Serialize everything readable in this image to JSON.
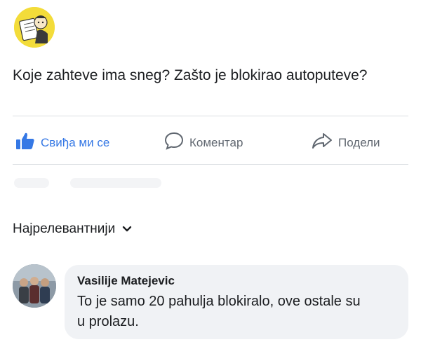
{
  "post": {
    "text": "Koje zahteve ima sneg? Zašto je blokirao autoputeve?"
  },
  "actions": {
    "like_label": "Свиђа ми се",
    "comment_label": "Коментар",
    "share_label": "Подели"
  },
  "comments": {
    "sort_label": "Најрелевантнији",
    "items": [
      {
        "author": "Vasilije Matejevic",
        "text": "To je samo 20 pahulja blokiralo, ove ostale su u prolazu."
      }
    ]
  },
  "colors": {
    "like_blue": "#3578e5",
    "bubble_bg": "#f0f2f5",
    "muted_text": "#606770"
  }
}
